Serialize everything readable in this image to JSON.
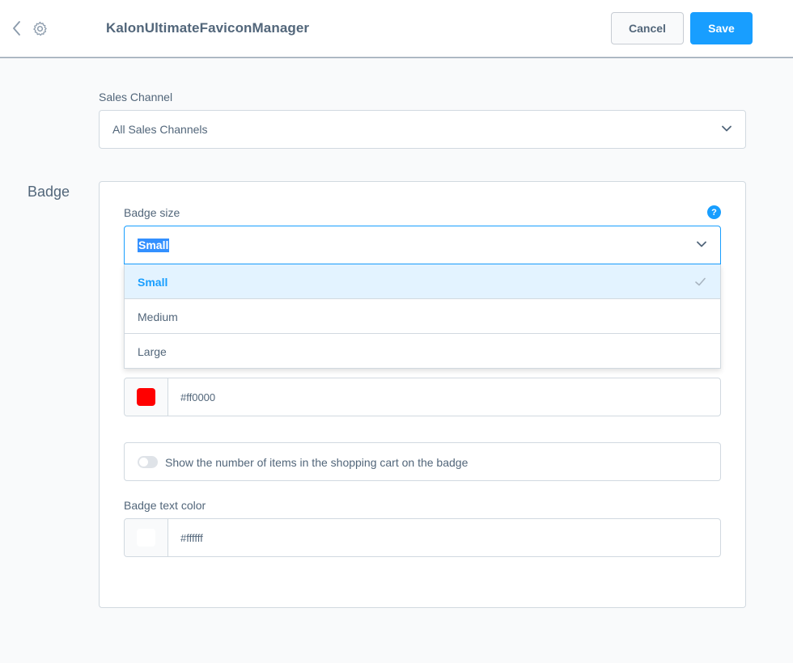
{
  "header": {
    "title": "KalonUltimateFaviconManager",
    "cancel_label": "Cancel",
    "save_label": "Save"
  },
  "sales_channel": {
    "label": "Sales Channel",
    "value": "All Sales Channels"
  },
  "badge_section": {
    "title": "Badge",
    "help_glyph": "?",
    "badge_size": {
      "label": "Badge size",
      "value": "Small",
      "options": [
        "Small",
        "Medium",
        "Large"
      ],
      "selected_index": 0
    },
    "badge_color": {
      "value": "#ff0000",
      "swatch": "#ff0000"
    },
    "show_count": {
      "label": "Show the number of items in the shopping cart on the badge",
      "enabled": false
    },
    "badge_text_color": {
      "label": "Badge text color",
      "value": "#ffffff",
      "swatch": "#ffffff"
    }
  },
  "colors": {
    "accent": "#189eff",
    "text": "#52667a",
    "border": "#d1d9e0"
  }
}
